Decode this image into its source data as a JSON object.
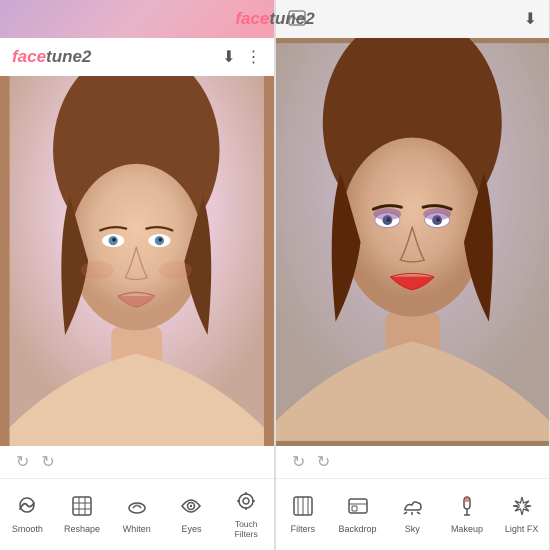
{
  "panels": [
    {
      "id": "left",
      "header": {
        "logo_face": "face",
        "logo_tune": "tune2",
        "icons": [
          "download",
          "more"
        ]
      },
      "undo_area": {
        "undo": "↺",
        "redo": "↻"
      },
      "toolbar": [
        {
          "id": "smooth",
          "label": "Smooth",
          "icon": "◯"
        },
        {
          "id": "reshape",
          "label": "Reshape",
          "icon": "⊞"
        },
        {
          "id": "whiten",
          "label": "Whiten",
          "icon": "⊙"
        },
        {
          "id": "eyes",
          "label": "Eyes",
          "icon": "👁"
        },
        {
          "id": "touch",
          "label": "Touch\nFilters",
          "icon": "✿"
        }
      ]
    },
    {
      "id": "right",
      "header": {
        "logo_face": "face",
        "logo_tune": "tune2",
        "icons": [
          "download"
        ]
      },
      "undo_area": {
        "undo": "↺",
        "redo": "↻"
      },
      "toolbar": [
        {
          "id": "filters",
          "label": "Filters",
          "icon": "⊡"
        },
        {
          "id": "backdrop",
          "label": "Backdrop",
          "icon": "⊟"
        },
        {
          "id": "sky",
          "label": "Sky",
          "icon": "☁"
        },
        {
          "id": "makeup",
          "label": "Makeup",
          "icon": "💄"
        },
        {
          "id": "lightfx",
          "label": "Light FX",
          "icon": "❋"
        }
      ]
    }
  ],
  "app_name_face": "face",
  "app_name_tune": "tune2",
  "icons": {
    "download": "⬇",
    "more": "⋮",
    "image": "🖼",
    "undo": "↺",
    "redo": "↻"
  }
}
